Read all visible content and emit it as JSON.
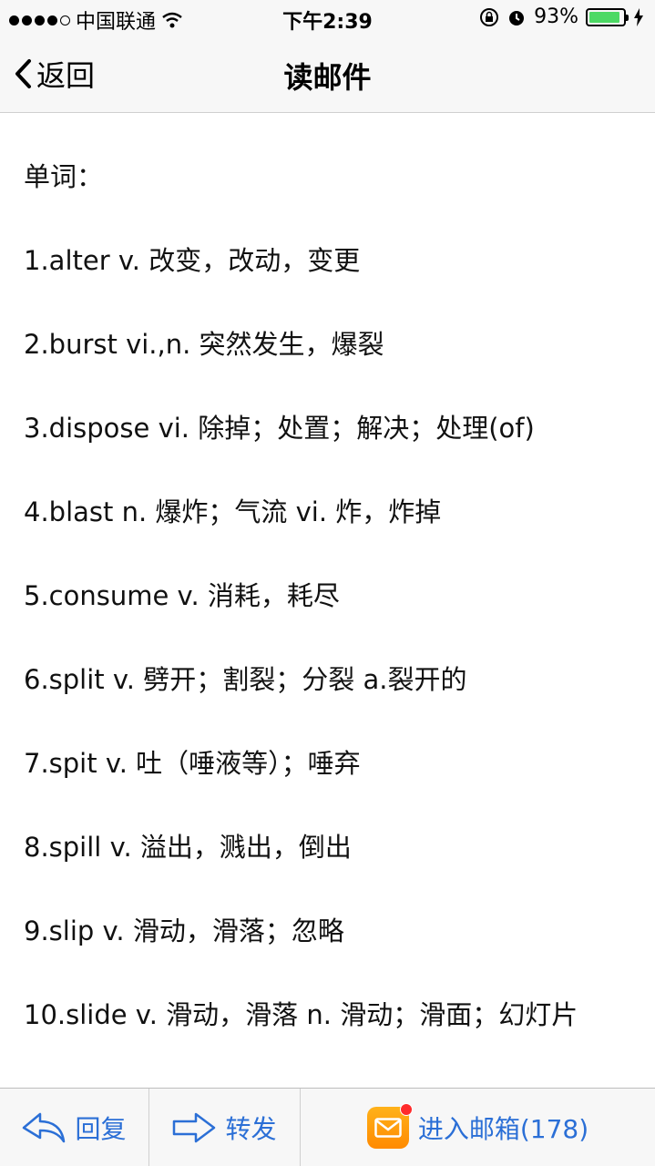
{
  "status": {
    "carrier": "中国联通",
    "time": "下午2:39",
    "battery_percent": "93%",
    "battery_level": 0.93,
    "battery_color": "#4cd964"
  },
  "nav": {
    "back_label": "返回",
    "title": "读邮件"
  },
  "email": {
    "lines": [
      "单词：",
      "1.alter v. 改变，改动，变更",
      "2.burst vi.,n. 突然发生，爆裂",
      "3.dispose vi. 除掉；处置；解决；处理(of)",
      "4.blast n. 爆炸；气流 vi. 炸，炸掉",
      "5.consume v. 消耗，耗尽",
      "6.split v. 劈开；割裂；分裂 a.裂开的",
      "7.spit v. 吐（唾液等）；唾弃",
      "8.spill v. 溢出，溅出，倒出",
      "9.slip v. 滑动，滑落；忽略",
      "10.slide v. 滑动，滑落 n. 滑动；滑面；幻灯片"
    ]
  },
  "toolbar": {
    "reply_label": "回复",
    "forward_label": "转发",
    "inbox_label": "进入邮箱(178)",
    "accent_color": "#2b6fd6"
  }
}
